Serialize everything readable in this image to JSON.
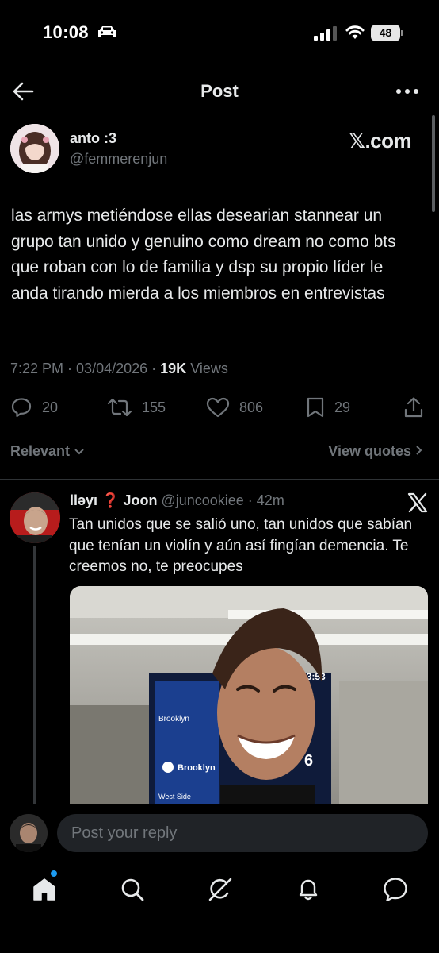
{
  "status_bar": {
    "time": "10:08",
    "battery": "48"
  },
  "header": {
    "title": "Post"
  },
  "post": {
    "author_name": "anto :3",
    "author_handle": "@femmerenjun",
    "source_label": "𝕏.com",
    "text": "las armys metiéndose ellas desearian stannear un grupo tan unido y genuino como dream no como bts que roban con lo de familia y dsp su propio líder le anda tirando mierda a los miembros en entrevistas",
    "time": "7:22 PM",
    "date": "03/04/2026",
    "views_count": "19K",
    "views_label": "Views",
    "replies": "20",
    "reposts": "155",
    "likes": "806",
    "bookmarks": "29"
  },
  "sort": {
    "relevant_label": "Relevant",
    "view_quotes_label": "View quotes"
  },
  "reply": {
    "name": "llǝyı ❓ Joon",
    "handle": "@juncookiee",
    "time": "42m",
    "text": "Tan unidos que se salió uno, tan unidos que sabían que tenían un violín y aún así fingían demencia. Te creemos no, te preocupes",
    "media_sign_1": "Brooklyn",
    "media_sign_2": "Brooklyn",
    "media_sign_3": "West Side",
    "media_clock": "23:53",
    "media_digit": "6"
  },
  "compose": {
    "placeholder": "Post your reply"
  },
  "colors": {
    "background": "#000000",
    "text_primary": "#e7e9ea",
    "text_secondary": "#71767b",
    "accent": "#1d9bf0",
    "input_bg": "#202327"
  },
  "icons": {
    "nav": [
      "home-icon",
      "search-icon",
      "grok-icon",
      "notifications-icon",
      "messages-icon"
    ]
  }
}
